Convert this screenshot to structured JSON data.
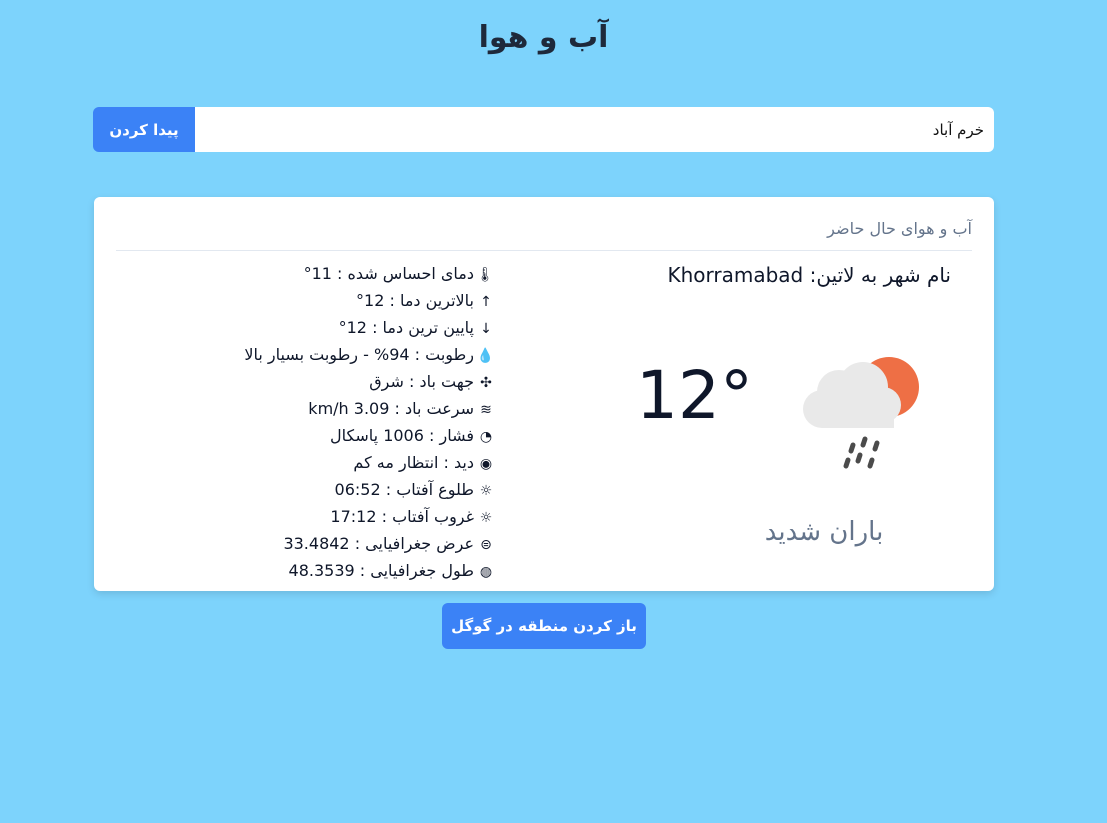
{
  "page": {
    "title": "آب و هوا"
  },
  "search": {
    "value": "خرم آباد",
    "button_label": "پیدا کردن"
  },
  "card": {
    "header": "آب و هوای حال حاضر",
    "city_name": "نام شهر به لاتین: Khorramabad",
    "temperature": "12°",
    "condition": "باران شدید",
    "weather_icon": "heavy-rain-cloud-sun-icon"
  },
  "details": [
    {
      "icon": "thermometer-icon",
      "glyph": "🌡",
      "text": "دمای احساس شده : 11°"
    },
    {
      "icon": "arrow-up-icon",
      "glyph": "↑",
      "text": "بالاترین دما : 12°"
    },
    {
      "icon": "arrow-down-icon",
      "glyph": "↓",
      "text": "پایین ترین دما : 12°"
    },
    {
      "icon": "droplet-icon",
      "glyph": "💧",
      "text": "رطوبت : 94% - رطوبت بسیار بالا"
    },
    {
      "icon": "pinwheel-icon",
      "glyph": "✣",
      "text": "جهت باد : شرق"
    },
    {
      "icon": "wind-icon",
      "glyph": "≋",
      "text": "سرعت باد : 3.09 km/h"
    },
    {
      "icon": "gauge-icon",
      "glyph": "◔",
      "text": "فشار : 1006 پاسکال"
    },
    {
      "icon": "eye-icon",
      "glyph": "◉",
      "text": "دید : انتظار مه کم"
    },
    {
      "icon": "sunrise-icon",
      "glyph": "☼",
      "text": "طلوع آفتاب : 06:52"
    },
    {
      "icon": "sunset-icon",
      "glyph": "☼",
      "text": "غروب آفتاب : 17:12"
    },
    {
      "icon": "latitude-icon",
      "glyph": "⊜",
      "text": "عرض جغرافیایی : 33.4842"
    },
    {
      "icon": "longitude-icon",
      "glyph": "◍",
      "text": "طول جغرافیایی : 48.3539"
    }
  ],
  "google_button": {
    "label": "باز کردن منطقه در گوگل"
  },
  "colors": {
    "background": "#7dd3fc",
    "accent": "#3b82f6",
    "sun": "#ee6f45"
  }
}
